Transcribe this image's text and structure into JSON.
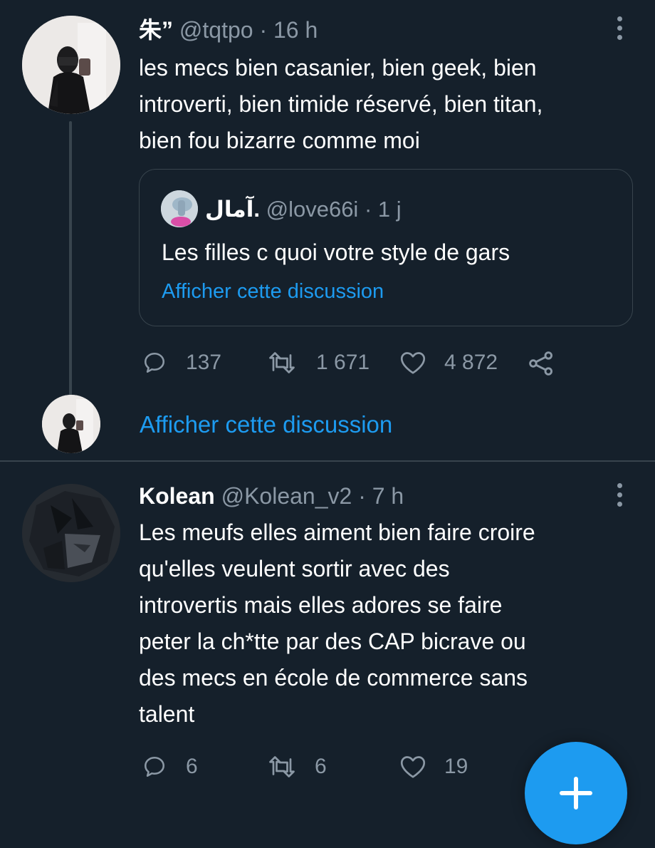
{
  "tweet1": {
    "display_name": "朱”",
    "handle": "@tqtpo",
    "separator": "·",
    "time": "16 h",
    "text_lines": [
      "les mecs bien casanier, bien geek, bien",
      "introverti, bien timide réservé, bien titan,",
      "bien fou bizarre comme moi"
    ],
    "quote": {
      "display_name": "آمال.",
      "handle": "@love66i",
      "separator": "·",
      "time": "1 j",
      "text": "Les filles c quoi votre style de gars",
      "show_thread": "Afficher cette discussion"
    },
    "actions": {
      "replies": "137",
      "retweets": "1 671",
      "likes": "4 872"
    }
  },
  "thread_link": "Afficher cette discussion",
  "tweet2": {
    "display_name": "Kolean",
    "handle": "@Kolean_v2",
    "separator": "·",
    "time": "7 h",
    "text_lines": [
      "Les meufs elles aiment bien faire croire",
      "qu'elles veulent sortir avec des",
      "introvertis mais elles adores se faire",
      "peter la ch*tte par des CAP bicrave ou",
      "des mecs en école de commerce sans",
      "talent"
    ],
    "actions": {
      "replies": "6",
      "retweets": "6",
      "likes": "19"
    }
  },
  "fab": {
    "icon": "plus-icon"
  },
  "colors": {
    "background": "#15202b",
    "text": "#ffffff",
    "muted": "#8b98a5",
    "accent": "#1d9bf0",
    "border": "#38444d"
  }
}
